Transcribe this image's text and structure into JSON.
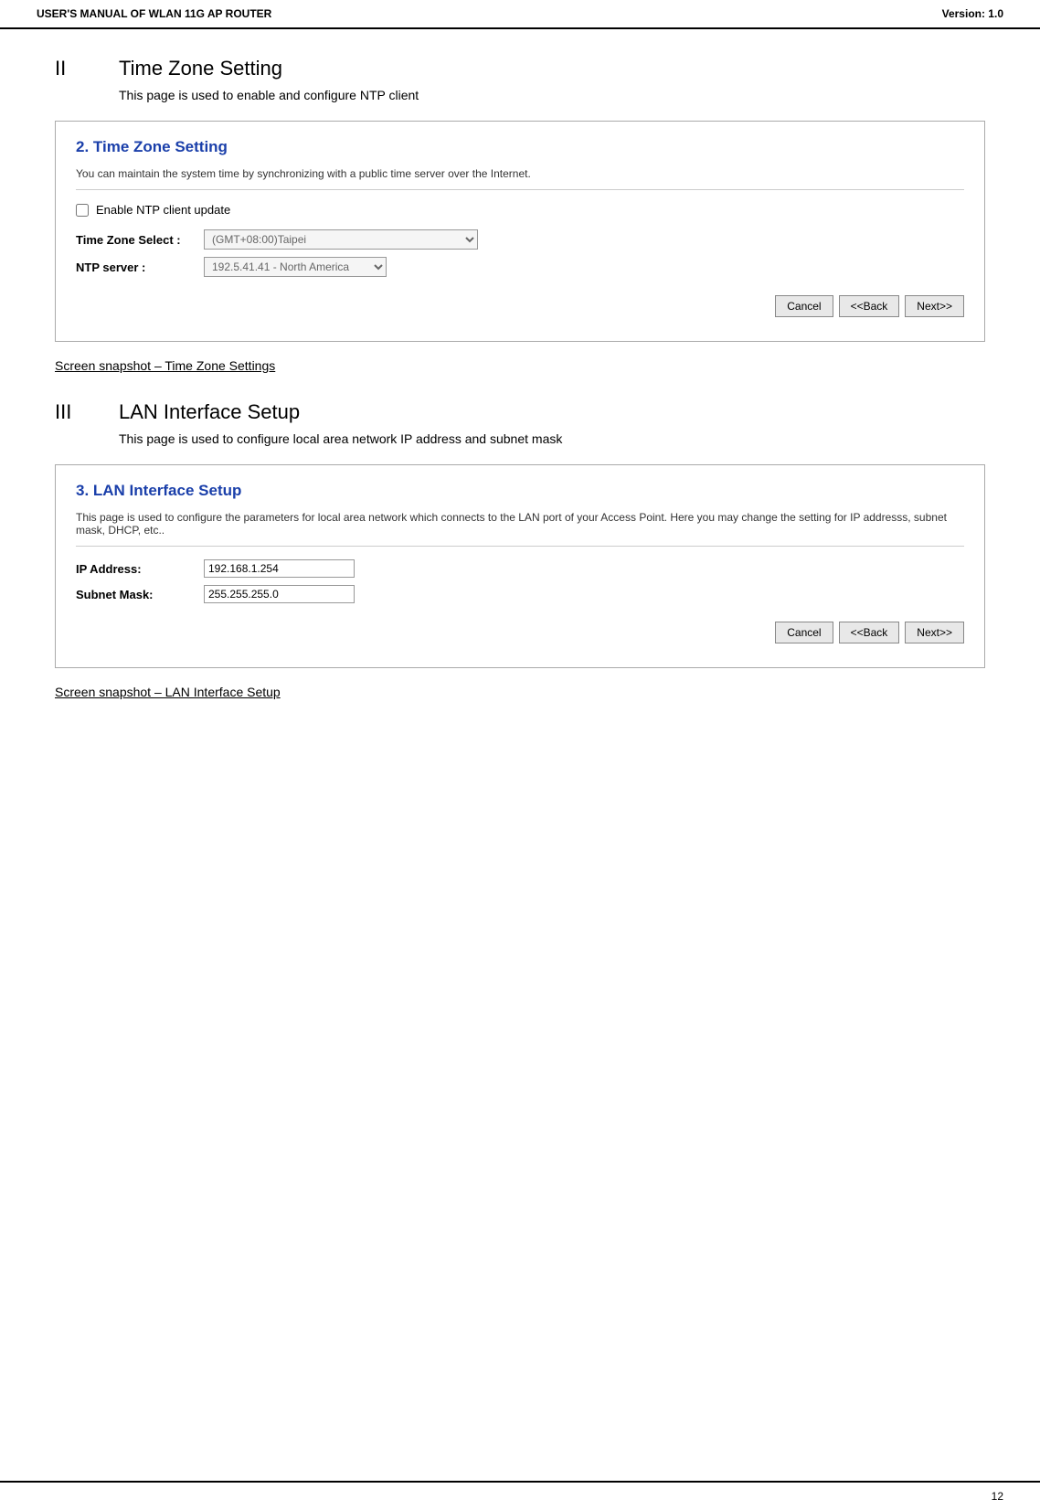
{
  "header": {
    "manual_title": "USER'S MANUAL OF WLAN 11G AP ROUTER",
    "version": "Version: 1.0"
  },
  "section2": {
    "number": "II",
    "title": "Time Zone Setting",
    "description": "This page is used to enable and configure NTP client",
    "box": {
      "title": "2. Time Zone Setting",
      "desc": "You can maintain the system time by synchronizing with a public time server over the Internet.",
      "checkbox_label": "Enable NTP client update",
      "fields": [
        {
          "label": "Time Zone Select :",
          "value": "(GMT+08:00)Taipei",
          "type": "select"
        },
        {
          "label": "NTP server :",
          "value": "192.5.41.41 - North America",
          "type": "select-small"
        }
      ],
      "buttons": {
        "cancel": "Cancel",
        "back": "<<Back",
        "next": "Next>>"
      }
    },
    "caption": "Screen snapshot – Time Zone Settings"
  },
  "section3": {
    "number": "III",
    "title": "LAN Interface Setup",
    "description": "This page is used to configure local area network IP address and subnet mask",
    "box": {
      "title": "3. LAN Interface Setup",
      "desc": "This page is used to configure the parameters for local area network which connects to the LAN port of your Access Point. Here you may change the setting for IP addresss, subnet mask, DHCP, etc..",
      "fields": [
        {
          "label": "IP Address:",
          "value": "192.168.1.254",
          "type": "input"
        },
        {
          "label": "Subnet Mask:",
          "value": "255.255.255.0",
          "type": "input"
        }
      ],
      "buttons": {
        "cancel": "Cancel",
        "back": "<<Back",
        "next": "Next>>"
      }
    },
    "caption": "Screen snapshot – LAN Interface Setup"
  },
  "footer": {
    "page_number": "12"
  }
}
